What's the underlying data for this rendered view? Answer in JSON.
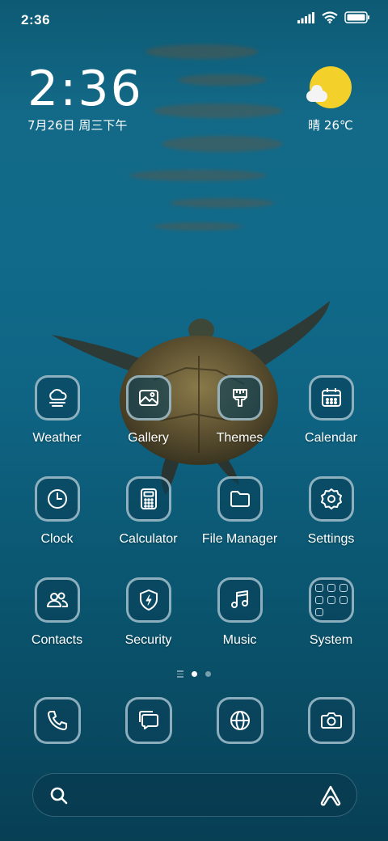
{
  "status_bar": {
    "time": "2:36",
    "icons": [
      "signal-icon",
      "wifi-icon",
      "battery-icon"
    ]
  },
  "clock_widget": {
    "time": "2:36",
    "date": "7月26日 周三下午"
  },
  "weather_widget": {
    "icon": "sunny-partly-cloudy-icon",
    "text": "晴 26℃"
  },
  "apps": [
    [
      {
        "name": "weather",
        "label": "Weather",
        "icon": "cloud-icon"
      },
      {
        "name": "gallery",
        "label": "Gallery",
        "icon": "image-icon"
      },
      {
        "name": "themes",
        "label": "Themes",
        "icon": "paintbrush-icon"
      },
      {
        "name": "calendar",
        "label": "Calendar",
        "icon": "calendar-icon"
      }
    ],
    [
      {
        "name": "clock",
        "label": "Clock",
        "icon": "clock-icon"
      },
      {
        "name": "calculator",
        "label": "Calculator",
        "icon": "calculator-icon"
      },
      {
        "name": "file-manager",
        "label": "File Manager",
        "icon": "folder-icon"
      },
      {
        "name": "settings",
        "label": "Settings",
        "icon": "gear-icon"
      }
    ],
    [
      {
        "name": "contacts",
        "label": "Contacts",
        "icon": "people-icon"
      },
      {
        "name": "security",
        "label": "Security",
        "icon": "shield-icon"
      },
      {
        "name": "music",
        "label": "Music",
        "icon": "music-note-icon"
      },
      {
        "name": "system",
        "label": "System",
        "icon": "folder-grid-icon"
      }
    ]
  ],
  "page_indicator": {
    "pages": 2,
    "current": 1
  },
  "dock": [
    {
      "name": "phone",
      "icon": "phone-icon"
    },
    {
      "name": "messages",
      "icon": "message-icon"
    },
    {
      "name": "browser",
      "icon": "globe-icon"
    },
    {
      "name": "camera",
      "icon": "camera-icon"
    }
  ],
  "search_bar": {
    "left_icon": "search-icon",
    "right_icon": "assistant-icon"
  },
  "colors": {
    "water_top": "#136a88",
    "water_bottom": "#073f55",
    "icon_border": "#b9d2de",
    "icon_fill": "#0a4158",
    "sun": "#f4d02a"
  }
}
